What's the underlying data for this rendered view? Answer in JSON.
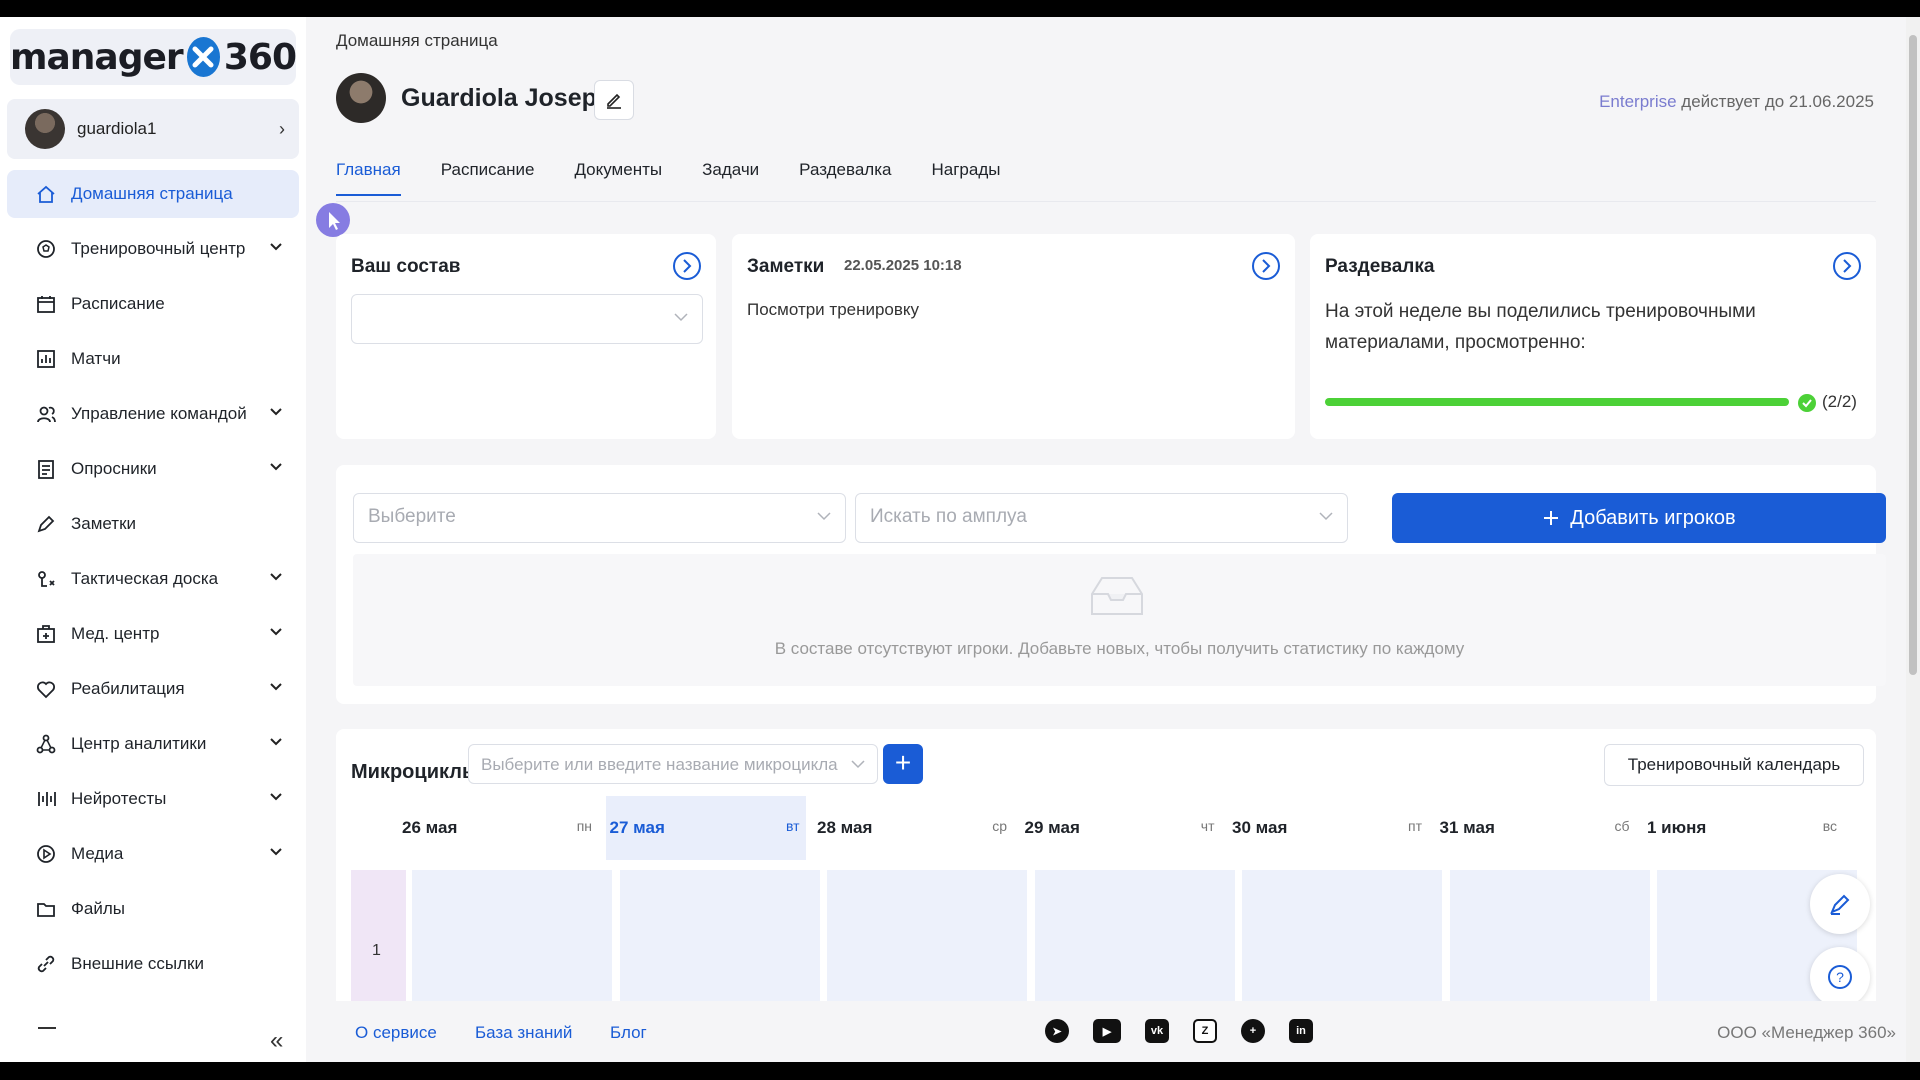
{
  "sidebar": {
    "logo_text": "manager",
    "logo_number": "360",
    "user": {
      "name": "guardiola1"
    },
    "items": [
      {
        "label": "Домашняя страница",
        "icon": "home-icon",
        "active": true,
        "expandable": false
      },
      {
        "label": "Тренировочный центр",
        "icon": "ball-icon",
        "expandable": true
      },
      {
        "label": "Расписание",
        "icon": "calendar-icon",
        "expandable": false
      },
      {
        "label": "Матчи",
        "icon": "stats-icon",
        "expandable": false
      },
      {
        "label": "Управление командой",
        "icon": "team-icon",
        "expandable": true
      },
      {
        "label": "Опросники",
        "icon": "survey-icon",
        "expandable": true
      },
      {
        "label": "Заметки",
        "icon": "pen-icon",
        "expandable": false
      },
      {
        "label": "Тактическая доска",
        "icon": "tactics-icon",
        "expandable": true
      },
      {
        "label": "Мед. центр",
        "icon": "medical-icon",
        "expandable": true
      },
      {
        "label": "Реабилитация",
        "icon": "heart-icon",
        "expandable": true
      },
      {
        "label": "Центр аналитики",
        "icon": "analytics-icon",
        "expandable": true
      },
      {
        "label": "Нейротесты",
        "icon": "neuro-icon",
        "expandable": true
      },
      {
        "label": "Медиа",
        "icon": "play-icon",
        "expandable": true
      },
      {
        "label": "Файлы",
        "icon": "folder-icon",
        "expandable": false
      },
      {
        "label": "Внешние ссылки",
        "icon": "link-icon",
        "expandable": false
      }
    ]
  },
  "header": {
    "breadcrumb": "Домашняя страница",
    "profile_name": "Guardiola Josep",
    "plan_name": "Enterprise",
    "plan_text": "действует до 21.06.2025",
    "tabs": [
      "Главная",
      "Расписание",
      "Документы",
      "Задачи",
      "Раздевалка",
      "Награды"
    ],
    "active_tab": "Главная"
  },
  "squad_card": {
    "title": "Ваш состав",
    "select_value": ""
  },
  "notes_card": {
    "title": "Заметки",
    "date": "22.05.2025 10:18",
    "text": "Посмотри тренировку"
  },
  "locker_card": {
    "title": "Раздевалка",
    "text": "На этой неделе вы поделились тренировочными материалами, просмотренно:",
    "progress_fraction": 1.0,
    "count": "(2/2)"
  },
  "players": {
    "select_placeholder": "Выберите",
    "role_placeholder": "Искать по амплуа",
    "add_button": "Добавить игроков",
    "empty_text": "В составе отсутствуют игроки. Добавьте новых, чтобы получить статистику по каждому"
  },
  "microcycles": {
    "title": "Микроциклы",
    "select_placeholder": "Выберите или введите название микроцикла",
    "plus_label": "+",
    "calendar_button": "Тренировочный календарь",
    "days": [
      {
        "date": "26 мая",
        "weekday": "пн",
        "highlight": false
      },
      {
        "date": "27 мая",
        "weekday": "вт",
        "highlight": true
      },
      {
        "date": "28 мая",
        "weekday": "ср",
        "highlight": false
      },
      {
        "date": "29 мая",
        "weekday": "чт",
        "highlight": false
      },
      {
        "date": "30 мая",
        "weekday": "пт",
        "highlight": false
      },
      {
        "date": "31 мая",
        "weekday": "сб",
        "highlight": false
      },
      {
        "date": "1 июня",
        "weekday": "вс",
        "highlight": false
      }
    ],
    "row_number": "1"
  },
  "footer": {
    "links": [
      "О сервисе",
      "База знаний",
      "Блог"
    ],
    "socials": [
      "telegram-icon",
      "youtube-icon",
      "vk-icon",
      "dzen-icon",
      "plus-icon",
      "linkedin-icon"
    ],
    "company": "ООО «Менеджер 360»"
  },
  "colors": {
    "accent": "#1a5cd6",
    "success": "#4cd137",
    "enterprise": "#7a7ccf"
  }
}
